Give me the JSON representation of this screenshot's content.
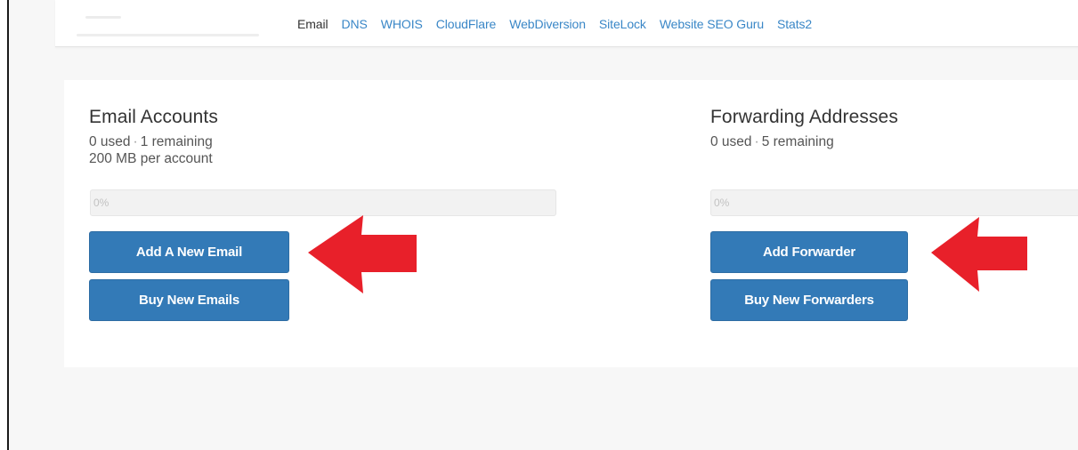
{
  "nav": {
    "items": [
      {
        "label": "Email",
        "active": true
      },
      {
        "label": "DNS",
        "active": false
      },
      {
        "label": "WHOIS",
        "active": false
      },
      {
        "label": "CloudFlare",
        "active": false
      },
      {
        "label": "WebDiversion",
        "active": false
      },
      {
        "label": "SiteLock",
        "active": false
      },
      {
        "label": "Website SEO Guru",
        "active": false
      },
      {
        "label": "Stats2",
        "active": false
      }
    ]
  },
  "email_accounts": {
    "title": "Email Accounts",
    "used": "0 used",
    "remaining": "1 remaining",
    "quota": "200 MB per account",
    "progress_label": "0%",
    "progress_value": 0,
    "add_button": "Add A New Email",
    "buy_button": "Buy New Emails"
  },
  "forwarding": {
    "title": "Forwarding Addresses",
    "used": "0 used",
    "remaining": "5 remaining",
    "progress_label": "0%",
    "progress_value": 0,
    "add_button": "Add Forwarder",
    "buy_button": "Buy New Forwarders"
  },
  "colors": {
    "link": "#3a87c7",
    "button": "#337ab7",
    "arrow": "#e8202a"
  },
  "annotations": {
    "arrow_icon": "red-arrow-left-icon"
  }
}
